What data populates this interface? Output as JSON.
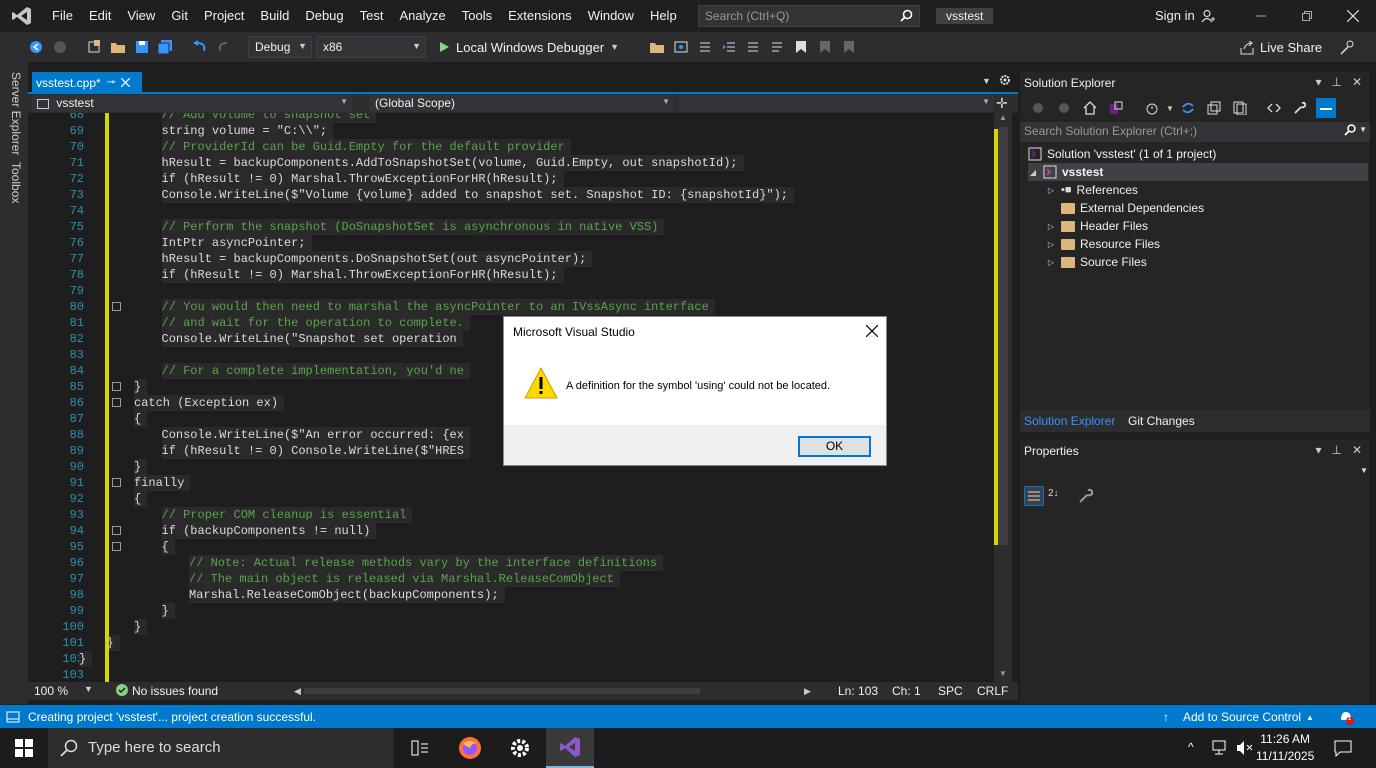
{
  "menubar": {
    "items": [
      "File",
      "Edit",
      "View",
      "Git",
      "Project",
      "Build",
      "Debug",
      "Test",
      "Analyze",
      "Tools",
      "Extensions",
      "Window",
      "Help"
    ],
    "search_placeholder": "Search (Ctrl+Q)",
    "solution_name": "vsstest",
    "sign_in": "Sign in"
  },
  "toolbar": {
    "config": "Debug",
    "platform": "x86",
    "run_target": "Local Windows Debugger",
    "live_share": "Live Share"
  },
  "side_tabs": [
    "Server Explorer",
    "Toolbox"
  ],
  "editor": {
    "tab_title": "vsstest.cpp*",
    "nav_project": "vsstest",
    "nav_scope": "(Global Scope)",
    "zoom": "100 %",
    "issues": "No issues found",
    "ln": "Ln: 103",
    "ch": "Ch: 1",
    "spc": "SPC",
    "crlf": "CRLF",
    "lines": [
      {
        "n": "68",
        "t": "// Add volume to snapshot set",
        "cls": "cm",
        "indent": 5,
        "hl": true
      },
      {
        "n": "69",
        "t": "string volume = \"C:\\\\\";",
        "cls": "tx",
        "indent": 5,
        "hl": true
      },
      {
        "n": "70",
        "t": "// ProviderId can be Guid.Empty for the default provider",
        "cls": "cm",
        "indent": 5,
        "hl": true
      },
      {
        "n": "71",
        "t": "hResult = backupComponents.AddToSnapshotSet(volume, Guid.Empty, out snapshotId);",
        "cls": "tx",
        "indent": 5,
        "hl": true
      },
      {
        "n": "72",
        "t": "if (hResult != 0) Marshal.ThrowExceptionForHR(hResult);",
        "cls": "tx",
        "indent": 5,
        "hl": true
      },
      {
        "n": "73",
        "t": "Console.WriteLine($\"Volume {volume} added to snapshot set. Snapshot ID: {snapshotId}\");",
        "cls": "tx",
        "indent": 5,
        "hl": true
      },
      {
        "n": "74",
        "t": "",
        "cls": "tx",
        "indent": 0,
        "hl": true
      },
      {
        "n": "75",
        "t": "// Perform the snapshot (DoSnapshotSet is asynchronous in native VSS)",
        "cls": "cm",
        "indent": 5,
        "hl": true
      },
      {
        "n": "76",
        "t": "IntPtr asyncPointer;",
        "cls": "tx",
        "indent": 5,
        "hl": true
      },
      {
        "n": "77",
        "t": "hResult = backupComponents.DoSnapshotSet(out asyncPointer);",
        "cls": "tx",
        "indent": 5,
        "hl": true
      },
      {
        "n": "78",
        "t": "if (hResult != 0) Marshal.ThrowExceptionForHR(hResult);",
        "cls": "tx",
        "indent": 5,
        "hl": true
      },
      {
        "n": "79",
        "t": "",
        "cls": "tx",
        "indent": 0,
        "hl": true
      },
      {
        "n": "80",
        "t": "// You would then need to marshal the asyncPointer to an IVssAsync interface",
        "cls": "cm",
        "indent": 5,
        "hl": true
      },
      {
        "n": "81",
        "t": "// and wait for the operation to complete.",
        "cls": "cm",
        "indent": 5,
        "hl": true
      },
      {
        "n": "82",
        "t": "Console.WriteLine(\"Snapshot set operation",
        "cls": "tx",
        "indent": 5,
        "hl": true
      },
      {
        "n": "83",
        "t": "",
        "cls": "tx",
        "indent": 0,
        "hl": true
      },
      {
        "n": "84",
        "t": "// For a complete implementation, you'd ne",
        "cls": "cm",
        "indent": 5,
        "hl": true
      },
      {
        "n": "85",
        "t": "}",
        "cls": "tx",
        "indent": 4,
        "hl": true
      },
      {
        "n": "86",
        "t": "catch (Exception ex)",
        "cls": "tx",
        "indent": 4,
        "hl": true
      },
      {
        "n": "87",
        "t": "{",
        "cls": "tx",
        "indent": 4,
        "hl": true
      },
      {
        "n": "88",
        "t": "Console.WriteLine($\"An error occurred: {ex",
        "cls": "tx",
        "indent": 5,
        "hl": true
      },
      {
        "n": "89",
        "t": "if (hResult != 0) Console.WriteLine($\"HRES",
        "cls": "tx",
        "indent": 5,
        "hl": true
      },
      {
        "n": "90",
        "t": "}",
        "cls": "tx",
        "indent": 4,
        "hl": true
      },
      {
        "n": "91",
        "t": "finally",
        "cls": "tx",
        "indent": 4,
        "hl": true
      },
      {
        "n": "92",
        "t": "{",
        "cls": "tx",
        "indent": 4,
        "hl": true
      },
      {
        "n": "93",
        "t": "// Proper COM cleanup is essential",
        "cls": "cm",
        "indent": 5,
        "hl": true
      },
      {
        "n": "94",
        "t": "if (backupComponents != null)",
        "cls": "tx",
        "indent": 5,
        "hl": true
      },
      {
        "n": "95",
        "t": "{",
        "cls": "tx",
        "indent": 5,
        "hl": true
      },
      {
        "n": "96",
        "t": "// Note: Actual release methods vary by the interface definitions",
        "cls": "cm",
        "indent": 6,
        "hl": true
      },
      {
        "n": "97",
        "t": "// The main object is released via Marshal.ReleaseComObject",
        "cls": "cm",
        "indent": 6,
        "hl": true
      },
      {
        "n": "98",
        "t": "Marshal.ReleaseComObject(backupComponents);",
        "cls": "tx",
        "indent": 6,
        "hl": true
      },
      {
        "n": "99",
        "t": "}",
        "cls": "tx",
        "indent": 5,
        "hl": true
      },
      {
        "n": "100",
        "t": "}",
        "cls": "tx",
        "indent": 4,
        "hl": true
      },
      {
        "n": "101",
        "t": "}",
        "cls": "tx",
        "indent": 3,
        "hl": true
      },
      {
        "n": "102",
        "t": "}",
        "cls": "tx",
        "indent": 2,
        "hl": true
      },
      {
        "n": "103",
        "t": "",
        "cls": "tx",
        "indent": 0,
        "hl": false
      }
    ]
  },
  "solution_explorer": {
    "title": "Solution Explorer",
    "search_placeholder": "Search Solution Explorer (Ctrl+;)",
    "solution": "Solution 'vsstest' (1 of 1 project)",
    "project": "vsstest",
    "items": [
      "References",
      "External Dependencies",
      "Header Files",
      "Resource Files",
      "Source Files"
    ],
    "tab_active": "Solution Explorer",
    "tab_other": "Git Changes"
  },
  "properties": {
    "title": "Properties"
  },
  "statusbar": {
    "message": "Creating project 'vsstest'... project creation successful.",
    "source_control": "Add to Source Control",
    "notifications": "1"
  },
  "taskbar": {
    "search_placeholder": "Type here to search",
    "time": "11:26 AM",
    "date": "11/11/2025"
  },
  "dialog": {
    "title": "Microsoft Visual Studio",
    "message": "A definition for the symbol 'using' could not be located.",
    "ok": "OK"
  }
}
